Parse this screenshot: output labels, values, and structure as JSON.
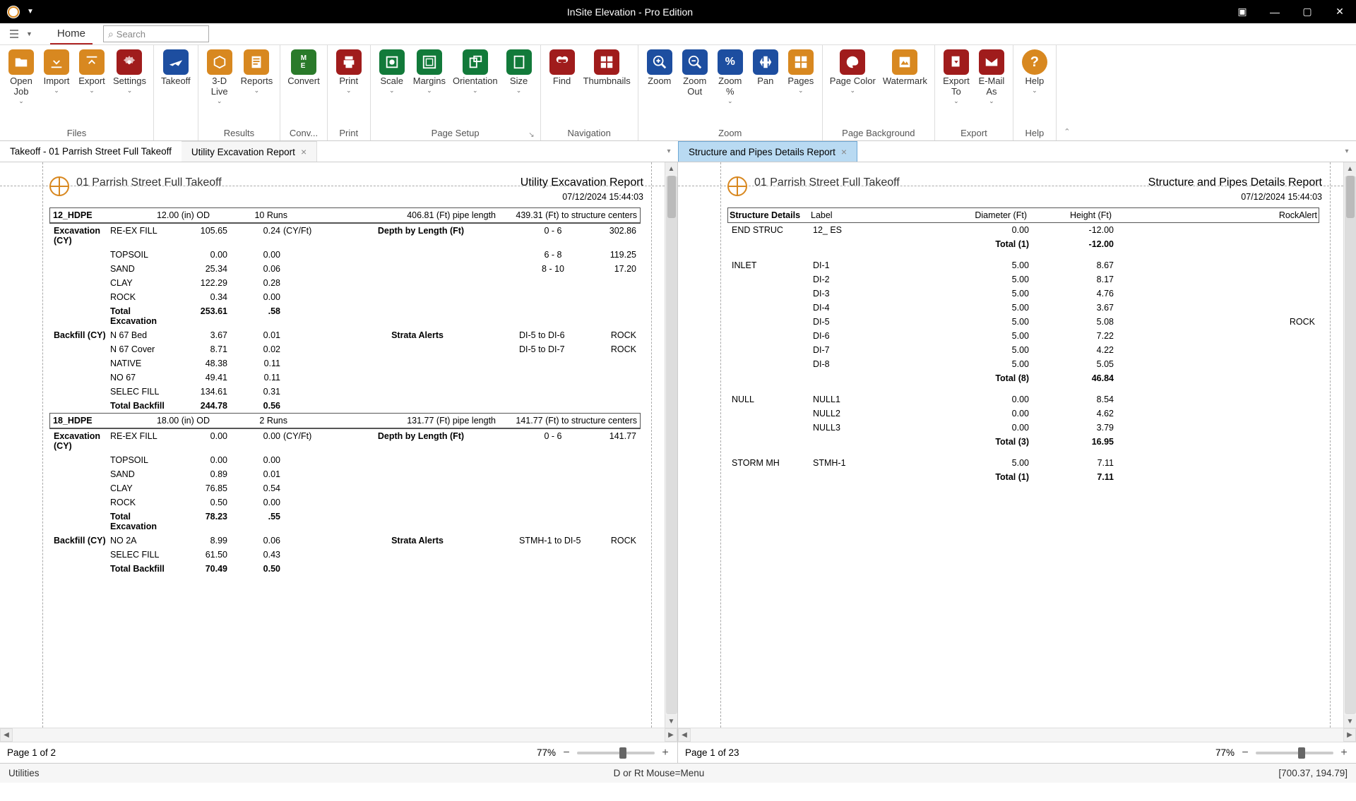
{
  "app": {
    "title": "InSite Elevation - Pro Edition"
  },
  "menu": {
    "home": "Home",
    "search_placeholder": "Search"
  },
  "ribbon": {
    "files": {
      "openjob": "Open\nJob",
      "import": "Import",
      "export": "Export",
      "settings": "Settings",
      "label": "Files"
    },
    "takeoff": "Takeoff",
    "results": {
      "live": "3-D\nLive",
      "reports": "Reports",
      "label": "Results"
    },
    "conv": {
      "convert": "Convert",
      "label": "Conv..."
    },
    "print": {
      "print": "Print",
      "label": "Print"
    },
    "pagesetup": {
      "scale": "Scale",
      "margins": "Margins",
      "orientation": "Orientation",
      "size": "Size",
      "label": "Page Setup"
    },
    "nav": {
      "find": "Find",
      "thumbs": "Thumbnails",
      "label": "Navigation"
    },
    "zoom": {
      "zoom": "Zoom",
      "zoomout": "Zoom\nOut",
      "zoompct": "Zoom\n%",
      "pan": "Pan",
      "pages": "Pages",
      "label": "Zoom"
    },
    "pagebg": {
      "color": "Page Color",
      "watermark": "Watermark",
      "label": "Page Background"
    },
    "export": {
      "exportto": "Export\nTo",
      "email": "E-Mail\nAs",
      "label": "Export"
    },
    "help": {
      "help": "Help",
      "label": "Help"
    }
  },
  "tabs": {
    "left": [
      "Takeoff - 01 Parrish Street Full Takeoff",
      "Utility Excavation Report"
    ],
    "right": [
      "Structure and Pipes Details Report"
    ]
  },
  "shared": {
    "project": "01 Parrish Street Full Takeoff",
    "stamp": "07/12/2024   15:44:03"
  },
  "leftReport": {
    "name": "Utility Excavation Report",
    "footer": {
      "page": "Page 1 of 2",
      "zoom": "77%"
    },
    "sections": [
      {
        "head": {
          "id": "12_HDPE",
          "od": "12.00 (in) OD",
          "runs": "10 Runs",
          "pipe": "406.81 (Ft) pipe length",
          "centers": "439.31 (Ft) to structure centers"
        },
        "excavation": {
          "title": "Excavation (CY)",
          "unit_label": "(CY/Ft)",
          "depth_label": "Depth by Length (Ft)",
          "rows": [
            {
              "m": "RE-EX FILL",
              "cy": "105.65",
              "cyft": "0.24",
              "depth": "0 - 6",
              "len": "302.86"
            },
            {
              "m": "TOPSOIL",
              "cy": "0.00",
              "cyft": "0.00",
              "depth": "6 - 8",
              "len": "119.25"
            },
            {
              "m": "SAND",
              "cy": "25.34",
              "cyft": "0.06",
              "depth": "8 - 10",
              "len": "17.20"
            },
            {
              "m": "CLAY",
              "cy": "122.29",
              "cyft": "0.28",
              "depth": "",
              "len": ""
            },
            {
              "m": "ROCK",
              "cy": "0.34",
              "cyft": "0.00",
              "depth": "",
              "len": ""
            }
          ],
          "total": {
            "label": "Total\nExcavation",
            "cy": "253.61",
            "cyft": ".58"
          }
        },
        "backfill": {
          "title": "Backfill (CY)",
          "alerts_label": "Strata Alerts",
          "rows": [
            {
              "m": "N 67 Bed",
              "cy": "3.67",
              "cyft": "0.01",
              "alert": "DI-5  to  DI-6",
              "r": "ROCK"
            },
            {
              "m": "N 67 Cover",
              "cy": "8.71",
              "cyft": "0.02",
              "alert": "DI-5  to  DI-7",
              "r": "ROCK"
            },
            {
              "m": "NATIVE",
              "cy": "48.38",
              "cyft": "0.11",
              "alert": "",
              "r": ""
            },
            {
              "m": "NO 67",
              "cy": "49.41",
              "cyft": "0.11",
              "alert": "",
              "r": ""
            },
            {
              "m": "SELEC FILL",
              "cy": "134.61",
              "cyft": "0.31",
              "alert": "",
              "r": ""
            }
          ],
          "total": {
            "label": "Total Backfill",
            "cy": "244.78",
            "cyft": "0.56"
          }
        }
      },
      {
        "head": {
          "id": "18_HDPE",
          "od": "18.00 (in) OD",
          "runs": "2 Runs",
          "pipe": "131.77 (Ft) pipe length",
          "centers": "141.77 (Ft) to structure centers"
        },
        "excavation": {
          "title": "Excavation (CY)",
          "unit_label": "(CY/Ft)",
          "depth_label": "Depth by Length (Ft)",
          "rows": [
            {
              "m": "RE-EX FILL",
              "cy": "0.00",
              "cyft": "0.00",
              "depth": "0 - 6",
              "len": "141.77"
            },
            {
              "m": "TOPSOIL",
              "cy": "0.00",
              "cyft": "0.00",
              "depth": "",
              "len": ""
            },
            {
              "m": "SAND",
              "cy": "0.89",
              "cyft": "0.01",
              "depth": "",
              "len": ""
            },
            {
              "m": "CLAY",
              "cy": "76.85",
              "cyft": "0.54",
              "depth": "",
              "len": ""
            },
            {
              "m": "ROCK",
              "cy": "0.50",
              "cyft": "0.00",
              "depth": "",
              "len": ""
            }
          ],
          "total": {
            "label": "Total\nExcavation",
            "cy": "78.23",
            "cyft": ".55"
          }
        },
        "backfill": {
          "title": "Backfill (CY)",
          "alerts_label": "Strata Alerts",
          "rows": [
            {
              "m": "NO 2A",
              "cy": "8.99",
              "cyft": "0.06",
              "alert": "STMH-1  to  DI-5",
              "r": "ROCK"
            },
            {
              "m": "SELEC FILL",
              "cy": "61.50",
              "cyft": "0.43",
              "alert": "",
              "r": ""
            }
          ],
          "total": {
            "label": "Total Backfill",
            "cy": "70.49",
            "cyft": "0.50"
          }
        }
      }
    ]
  },
  "rightReport": {
    "name": "Structure and Pipes Details Report",
    "footer": {
      "page": "Page 1 of 23",
      "zoom": "77%"
    },
    "columns": {
      "c1": "Structure Details",
      "c2": "Label",
      "c3": "Diameter (Ft)",
      "c4": "Height (Ft)",
      "c5": "RockAlert"
    },
    "groups": [
      {
        "name": "END STRUC",
        "rows": [
          {
            "l": "12_ ES",
            "d": "0.00",
            "h": "-12.00",
            "r": ""
          }
        ],
        "total": {
          "label": "Total (1)",
          "h": "-12.00"
        }
      },
      {
        "name": "INLET",
        "rows": [
          {
            "l": "DI-1",
            "d": "5.00",
            "h": "8.67",
            "r": ""
          },
          {
            "l": "DI-2",
            "d": "5.00",
            "h": "8.17",
            "r": ""
          },
          {
            "l": "DI-3",
            "d": "5.00",
            "h": "4.76",
            "r": ""
          },
          {
            "l": "DI-4",
            "d": "5.00",
            "h": "3.67",
            "r": ""
          },
          {
            "l": "DI-5",
            "d": "5.00",
            "h": "5.08",
            "r": "ROCK"
          },
          {
            "l": "DI-6",
            "d": "5.00",
            "h": "7.22",
            "r": ""
          },
          {
            "l": "DI-7",
            "d": "5.00",
            "h": "4.22",
            "r": ""
          },
          {
            "l": "DI-8",
            "d": "5.00",
            "h": "5.05",
            "r": ""
          }
        ],
        "total": {
          "label": "Total (8)",
          "h": "46.84"
        }
      },
      {
        "name": "NULL",
        "rows": [
          {
            "l": "NULL1",
            "d": "0.00",
            "h": "8.54",
            "r": ""
          },
          {
            "l": "NULL2",
            "d": "0.00",
            "h": "4.62",
            "r": ""
          },
          {
            "l": "NULL3",
            "d": "0.00",
            "h": "3.79",
            "r": ""
          }
        ],
        "total": {
          "label": "Total (3)",
          "h": "16.95"
        }
      },
      {
        "name": "STORM MH",
        "rows": [
          {
            "l": "STMH-1",
            "d": "5.00",
            "h": "7.11",
            "r": ""
          }
        ],
        "total": {
          "label": "Total (1)",
          "h": "7.11"
        }
      }
    ]
  },
  "statusbar": {
    "left": "Utilities",
    "center": "D or Rt Mouse=Menu",
    "right": "[700.37, 194.79]"
  }
}
